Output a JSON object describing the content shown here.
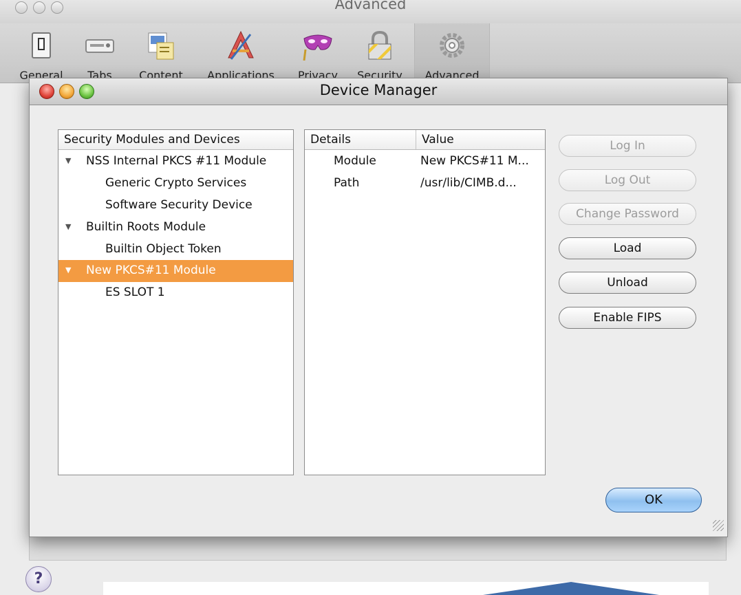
{
  "prefs_window": {
    "title": "Advanced",
    "toolbar": [
      {
        "label": "General",
        "icon": "switch-icon"
      },
      {
        "label": "Tabs",
        "icon": "tabs-icon"
      },
      {
        "label": "Content",
        "icon": "content-icon"
      },
      {
        "label": "Applications",
        "icon": "applications-icon"
      },
      {
        "label": "Privacy",
        "icon": "mask-icon"
      },
      {
        "label": "Security",
        "icon": "lock-icon"
      },
      {
        "label": "Advanced",
        "icon": "gear-icon"
      }
    ],
    "selected_tab": "Advanced",
    "help": "?"
  },
  "dialog": {
    "title": "Device Manager",
    "tree": {
      "header": "Security Modules and Devices",
      "items": [
        {
          "label": "NSS Internal PKCS #11 Module",
          "level": 0,
          "expanded": true
        },
        {
          "label": "Generic Crypto Services",
          "level": 1
        },
        {
          "label": "Software Security Device",
          "level": 1
        },
        {
          "label": "Builtin Roots Module",
          "level": 0,
          "expanded": true
        },
        {
          "label": "Builtin Object Token",
          "level": 1
        },
        {
          "label": "New PKCS#11 Module",
          "level": 0,
          "expanded": true,
          "selected": true
        },
        {
          "label": "ES SLOT 1",
          "level": 1
        }
      ]
    },
    "details": {
      "headers": [
        "Details",
        "Value"
      ],
      "rows": [
        {
          "detail": "Module",
          "value": "New PKCS#11 M..."
        },
        {
          "detail": "Path",
          "value": "/usr/lib/CIMB.d..."
        }
      ]
    },
    "buttons": {
      "log_in": "Log In",
      "log_out": "Log Out",
      "change_password": "Change Password",
      "load": "Load",
      "unload": "Unload",
      "enable_fips": "Enable FIPS",
      "ok": "OK"
    },
    "colors": {
      "selection": "#f39b42",
      "ok_button": "#8fc0ef"
    }
  }
}
